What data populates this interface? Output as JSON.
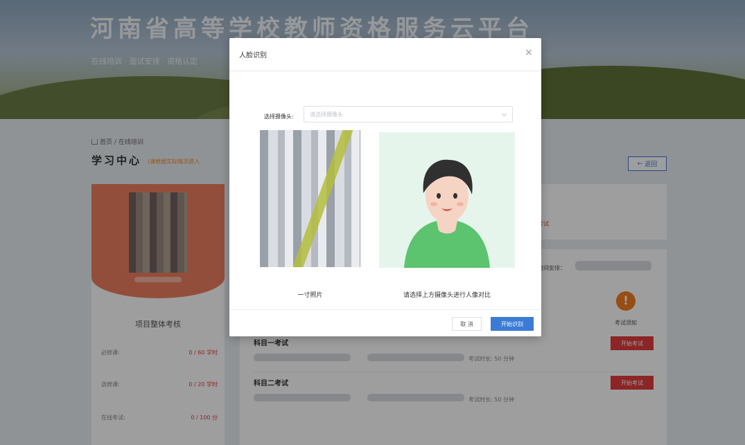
{
  "header": {
    "title": "河南省高等学校教师资格服务云平台",
    "subtitle": "在线培训 · 面试安排 · 资格认定"
  },
  "breadcrumb": {
    "home": "首页",
    "separator": "/",
    "current": "在线培训"
  },
  "page": {
    "title": "学习中心",
    "hint": "(请根据实际情况进入",
    "back_label": "返回"
  },
  "left_card": {
    "summary_title": "项目整体考核",
    "stats": [
      {
        "label": "必修课:",
        "value": "0 / 60 学时"
      },
      {
        "label": "选修课:",
        "value": "0 / 20 学时"
      },
      {
        "label": "在线考试:",
        "value": "0 / 100 分"
      }
    ]
  },
  "right_panel": {
    "fragment_a": "]",
    "fragment_b": "考试",
    "fragment_c": "时间安排：",
    "exam_notice": "考试须知",
    "subjects": [
      {
        "title": "科目一考试",
        "duration": "考试时长: 50 分钟",
        "button": "开始考试"
      },
      {
        "title": "科目二考试",
        "duration": "考试时长: 50 分钟",
        "button": "开始考试"
      }
    ]
  },
  "modal": {
    "title": "人脸识别",
    "close_symbol": "×",
    "camera_label": "选择摄像头:",
    "camera_placeholder": "请选择摄像头",
    "photo_caption": "一寸照片",
    "camera_caption": "请选择上方摄像头进行人像对比",
    "cancel_label": "取 消",
    "start_label": "开始识别"
  },
  "icons": {
    "home": "home-icon",
    "back": "arrow-left-icon",
    "notice": "exclamation-icon",
    "close": "close-icon",
    "dropdown": "chevron-down-icon"
  },
  "colors": {
    "primary": "#3a7bd5",
    "danger": "#e23c3c",
    "warning": "#f57c1f",
    "banner": "#ee7f5f",
    "placeholder_bg": "#e5f5ec"
  }
}
